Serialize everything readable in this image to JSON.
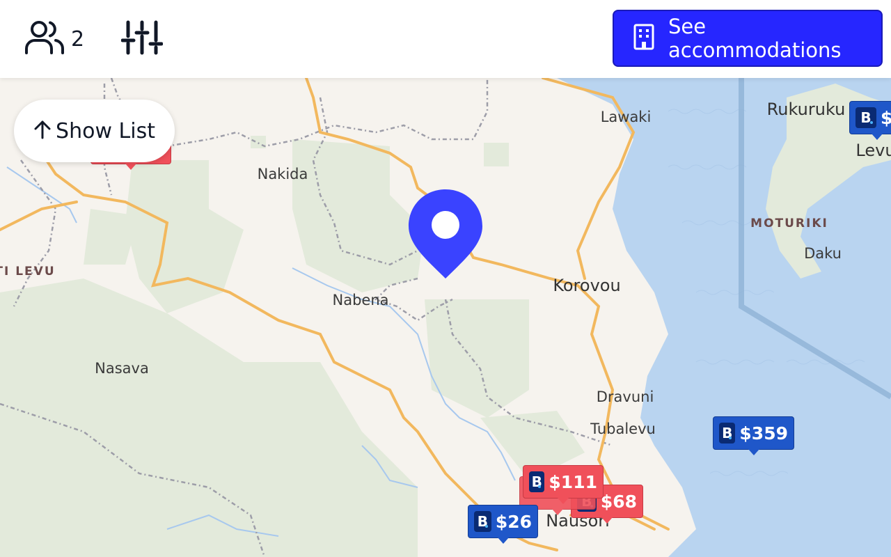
{
  "header": {
    "guest_count": "2",
    "cta_label": "See accommodations"
  },
  "map": {
    "show_list_label": "Show List",
    "places": {
      "lawaki": "Lawaki",
      "rukuruku": "Rukuruku",
      "levu": "Levu",
      "nakida": "Nakida",
      "moturiki": "MOTURIKI",
      "daku": "Daku",
      "ti_levu": "TI LEVU",
      "korovou": "Korovou",
      "nabena": "Nabena",
      "nasava": "Nasava",
      "dravuni": "Dravuni",
      "tubalevu": "Tubalevu",
      "nausori": "Nausori"
    },
    "markers": [
      {
        "price": "$",
        "color": "blue",
        "partner_icon": "booking-b-icon"
      },
      {
        "price": "$359",
        "color": "blue",
        "partner_icon": "booking-b-icon"
      },
      {
        "price": "$111",
        "color": "red",
        "partner_icon": "booking-b-icon"
      },
      {
        "price": "$68",
        "color": "red",
        "partner_icon": "booking-b-icon"
      },
      {
        "price": "$26",
        "color": "blue",
        "partner_icon": "booking-b-icon"
      }
    ],
    "colors": {
      "land": "#f6f3ee",
      "water": "#b9d4f0",
      "park": "#e3eadb",
      "road": "#f2b85e",
      "pin": "#3a43ff",
      "cta": "#2626ff"
    }
  }
}
